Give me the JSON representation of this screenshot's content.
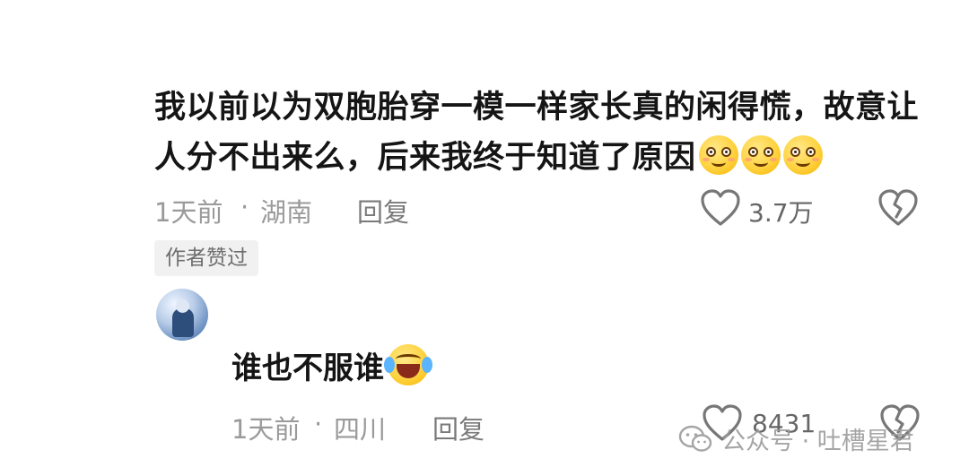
{
  "comment": {
    "text": "我以前以为双胞胎穿一模一样家长真的闲得慌，故意让人分不出来么，后来我终于知道了原因",
    "emoji": [
      "blushing-smile-icon",
      "blushing-smile-icon",
      "blushing-smile-icon"
    ],
    "time": "1天前",
    "separator": "·",
    "location": "湖南",
    "reply_label": "回复",
    "like_count": "3.7万",
    "author_liked_badge": "作者赞过"
  },
  "reply": {
    "text": "谁也不服谁",
    "emoji": "laughing-tears-icon",
    "time": "1天前",
    "separator": "·",
    "location": "四川",
    "reply_label": "回复",
    "like_count": "8431"
  },
  "watermark": {
    "text": "公众号 · 吐槽星君",
    "icon": "wechat-icon"
  },
  "colors": {
    "text": "#151515",
    "meta": "#9a9a9a",
    "badge_bg": "#f1f1f1",
    "emoji": "#ffd23f"
  }
}
